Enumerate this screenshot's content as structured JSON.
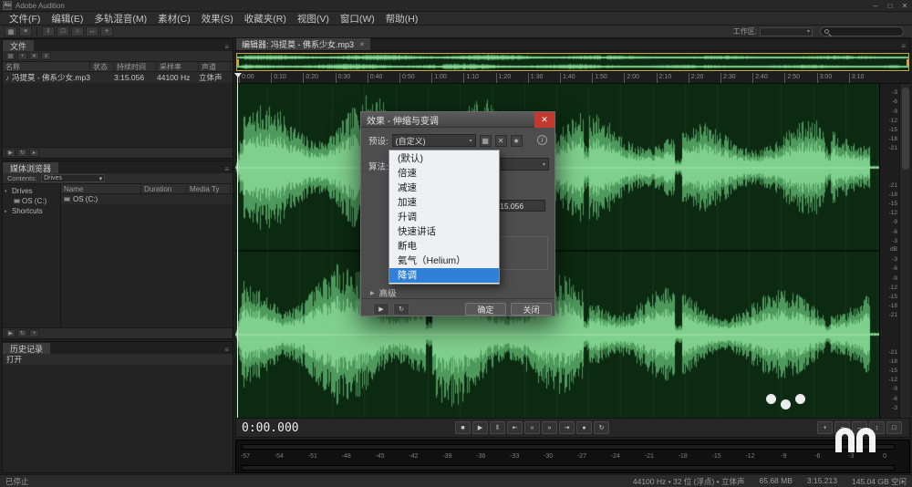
{
  "titlebar": {
    "icon_text": "Au",
    "title": "Adobe Audition",
    "minimize": "–",
    "maximize": "□",
    "close": "✕"
  },
  "menu": {
    "items": [
      "文件(F)",
      "编辑(E)",
      "多轨混音(M)",
      "素材(C)",
      "效果(S)",
      "收藏夹(R)",
      "视图(V)",
      "窗口(W)",
      "帮助(H)"
    ]
  },
  "toolbar": {
    "workspace_label": "工作区:",
    "left_icons": [
      {
        "name": "waveform-view-icon",
        "glyph": "▦"
      },
      {
        "name": "multitrack-view-icon",
        "glyph": "≡"
      }
    ],
    "tools": [
      {
        "name": "time-selection-tool-icon",
        "glyph": "I"
      },
      {
        "name": "marquee-selection-tool-icon",
        "glyph": "□"
      },
      {
        "name": "lasso-selection-tool-icon",
        "glyph": "○"
      },
      {
        "name": "slip-tool-icon",
        "glyph": "↔"
      },
      {
        "name": "spot-healing-tool-icon",
        "glyph": "+"
      }
    ]
  },
  "icons": {
    "panel_menu": "≡",
    "dropdown_arrow": "▾",
    "tree_expanded": "▾",
    "tree_collapsed": "▸",
    "note": "♪",
    "info": "i",
    "star": "★",
    "save": "▦",
    "delete": "✕",
    "play": "▶",
    "loop": "↻",
    "advanced_arrow": "▶"
  },
  "files_panel": {
    "tab": "文件",
    "columns": [
      "名称",
      "状态",
      "持续时间",
      "采样率",
      "声道"
    ],
    "file": {
      "name": "冯提莫 - 佛系少女.mp3",
      "duration": "3:15.056",
      "sample_rate": "44100 Hz",
      "channels": "立体声"
    },
    "toolbar": [
      {
        "name": "import-file-icon",
        "glyph": "▤"
      },
      {
        "name": "new-content-icon",
        "glyph": "+"
      },
      {
        "name": "close-file-icon",
        "glyph": "✕"
      },
      {
        "name": "insert-into-multitrack-icon",
        "glyph": "≡"
      }
    ],
    "footer": [
      {
        "name": "play-file-icon",
        "glyph": "▶"
      },
      {
        "name": "loop-playback-icon",
        "glyph": "↻"
      },
      {
        "name": "auto-play-icon",
        "glyph": "▸"
      }
    ]
  },
  "media_panel": {
    "tab": "媒体浏览器",
    "location_label": "Contents:",
    "location_value": "Drives",
    "tree": [
      "Drives",
      "OS (C:)",
      "Shortcuts"
    ],
    "columns": [
      "Name",
      "Duration",
      "Media Ty"
    ],
    "row_name": "OS (C:)",
    "footer": [
      {
        "name": "play-media-icon",
        "glyph": "▶"
      },
      {
        "name": "loop-media-icon",
        "glyph": "↻"
      },
      {
        "name": "add-shortcut-icon",
        "glyph": "+"
      }
    ]
  },
  "history_panel": {
    "tab": "历史记录",
    "items": [
      "打开"
    ]
  },
  "editor": {
    "tab_label": "编辑器: 冯提莫 - 佛系少女.mp3",
    "close_glyph": "✕",
    "timeline": [
      "0:00",
      "0:10",
      "0:20",
      "0:30",
      "0:40",
      "0:50",
      "1:00",
      "1:10",
      "1:20",
      "1:30",
      "1:40",
      "1:50",
      "2:00",
      "2:10",
      "2:20",
      "2:30",
      "2:40",
      "2:50",
      "3:00",
      "3:10"
    ],
    "db_labels": [
      "-3",
      "-6",
      "-9",
      "-12",
      "-15",
      "-18",
      "-21"
    ],
    "db_unit": "dB"
  },
  "transport": {
    "time": "0:00.000",
    "buttons": [
      {
        "name": "stop-button",
        "glyph": "■"
      },
      {
        "name": "play-button",
        "glyph": "▶"
      },
      {
        "name": "pause-button",
        "glyph": "‖"
      },
      {
        "name": "skip-to-start-button",
        "glyph": "⇤"
      },
      {
        "name": "rewind-button",
        "glyph": "«"
      },
      {
        "name": "fast-forward-button",
        "glyph": "»"
      },
      {
        "name": "skip-to-end-button",
        "glyph": "⇥"
      },
      {
        "name": "record-button",
        "glyph": "●"
      },
      {
        "name": "loop-playback-button",
        "glyph": "↻"
      }
    ],
    "zoom_buttons": [
      {
        "name": "zoom-in-button",
        "glyph": "+"
      },
      {
        "name": "zoom-out-button",
        "glyph": "−"
      },
      {
        "name": "zoom-in-horizontal-button",
        "glyph": "↔"
      },
      {
        "name": "zoom-in-vertical-button",
        "glyph": "↕"
      },
      {
        "name": "zoom-full-button",
        "glyph": "□"
      }
    ]
  },
  "levels": {
    "scale": [
      "-57",
      "-54",
      "-51",
      "-48",
      "-45",
      "-42",
      "-39",
      "-36",
      "-33",
      "-30",
      "-27",
      "-24",
      "-21",
      "-18",
      "-15",
      "-12",
      "-9",
      "-6",
      "-3",
      "0"
    ]
  },
  "status_bar": {
    "message": "已停止",
    "format": "44100 Hz • 32 位 (浮点) • 立体声",
    "size": "65.68 MB",
    "duration": "3:15.213",
    "free_space": "145.04 GB 空闲"
  },
  "dialog": {
    "title": "效果 - 伸缩与变调",
    "preset_label": "预设:",
    "preset_value": "(自定义)",
    "algorithm_label": "算法:",
    "duration_value": "3:15.056",
    "presets": [
      "(默认)",
      "倍速",
      "减速",
      "加速",
      "升调",
      "快速讲话",
      "断电",
      "氦气（Helium）",
      "降调"
    ],
    "selected_preset": "降调",
    "advanced_label": "高级",
    "ok_label": "确定",
    "close_label": "关闭"
  },
  "colors": {
    "wave_bg": "#0c2a12",
    "wave_main": "#4e9a5c",
    "wave_bright": "#7fd08d",
    "wave_center": "#a5e4b0",
    "selection_border": "#d2a63f",
    "highlight_blue": "#2f80d9",
    "close_red": "#c23a2e"
  }
}
